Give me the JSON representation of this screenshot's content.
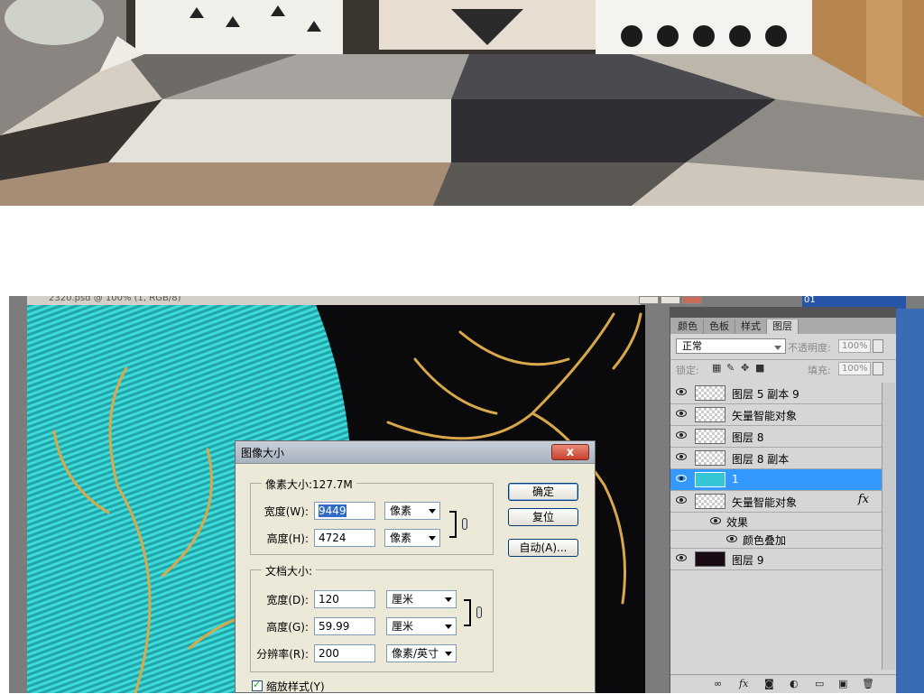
{
  "document": {
    "title": "2320.psd @ 100% (1, RGB/8)"
  },
  "dialog": {
    "title": "图像大小",
    "close_label": "x",
    "pixel_dims": {
      "legend": "像素大小:127.7M",
      "width_label": "宽度(W):",
      "width_value": "9449",
      "width_unit": "像素",
      "height_label": "高度(H):",
      "height_value": "4724",
      "height_unit": "像素"
    },
    "doc_size": {
      "legend": "文档大小:",
      "width_label": "宽度(D):",
      "width_value": "120",
      "width_unit": "厘米",
      "height_label": "高度(G):",
      "height_value": "59.99",
      "height_unit": "厘米",
      "resolution_label": "分辨率(R):",
      "resolution_value": "200",
      "resolution_unit": "像素/英寸"
    },
    "buttons": {
      "ok": "确定",
      "reset": "复位",
      "auto": "自动(A)..."
    },
    "scale_styles_label": "缩放样式(Y)"
  },
  "layers_panel": {
    "tabs": [
      "颜色",
      "色板",
      "样式",
      "图层"
    ],
    "active_tab": "图层",
    "blend_mode": "正常",
    "opacity_label": "不透明度:",
    "opacity_value": "100%",
    "lock_label": "锁定:",
    "fill_label": "填充:",
    "fill_value": "100%",
    "layers": [
      {
        "name": "图层 5 副本 9",
        "active": false
      },
      {
        "name": "矢量智能对象",
        "active": false
      },
      {
        "name": "图层 8",
        "active": false
      },
      {
        "name": "图层 8 副本",
        "active": false
      },
      {
        "name": "1",
        "active": true
      },
      {
        "name": "矢量智能对象",
        "active": false,
        "fx": "fx"
      },
      {
        "name": "图层 9",
        "active": false
      }
    ],
    "effects_label": "效果",
    "effect_item": "颜色叠加",
    "bottom_icons": [
      "link-icon",
      "fx-icon",
      "mask-icon",
      "adjustment-icon",
      "folder-icon",
      "new-layer-icon",
      "trash-icon"
    ]
  },
  "corner_label": "01"
}
